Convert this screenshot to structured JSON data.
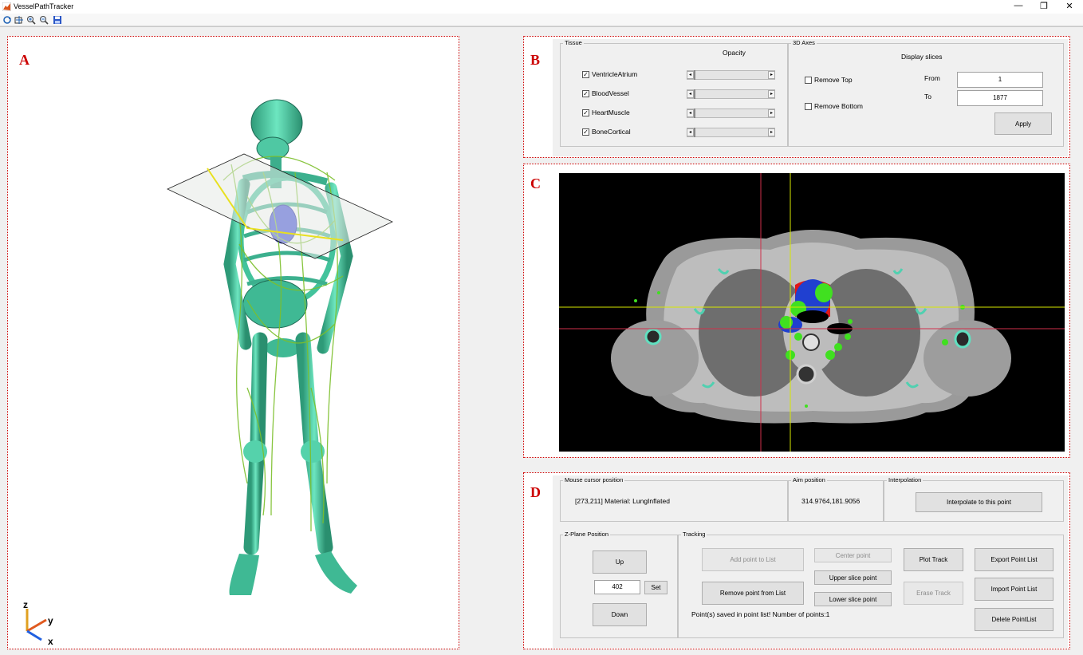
{
  "window": {
    "title": "VesselPathTracker"
  },
  "toolbar": {
    "buttons": [
      "rotate-icon",
      "data-cursor-icon",
      "zoom-in-icon",
      "zoom-out-icon",
      "save-icon"
    ]
  },
  "regions": {
    "a": "A",
    "b": "B",
    "c": "C",
    "d": "D"
  },
  "volume_view": {
    "axes": {
      "z": "z",
      "y": "y",
      "x": "x"
    }
  },
  "tissue_panel": {
    "title": "Tissue",
    "opacity_label": "Opacity",
    "items": [
      {
        "label": "VentricleAtrium",
        "checked": true
      },
      {
        "label": "BloodVessel",
        "checked": true
      },
      {
        "label": "HeartMuscle",
        "checked": true
      },
      {
        "label": "BoneCortical",
        "checked": true
      }
    ]
  },
  "axes_panel": {
    "title": "3D Axes",
    "display_slices_label": "Display slices",
    "remove_top_label": "Remove Top",
    "remove_bottom_label": "Remove Bottom",
    "remove_top_checked": false,
    "remove_bottom_checked": false,
    "from_label": "From",
    "to_label": "To",
    "from_value": "1",
    "to_value": "1877",
    "apply_label": "Apply"
  },
  "mouse_panel": {
    "title": "Mouse cursor  position",
    "value": "[273,211] Material:  LungInflated"
  },
  "aim_panel": {
    "title": "Aim position",
    "value": "314.9764,181.9056"
  },
  "interp_panel": {
    "title": "Interpolation",
    "button_label": "Interpolate to this point"
  },
  "zplane_panel": {
    "title": "Z-Plane Position",
    "up_label": "Up",
    "value": "402",
    "set_label": "Set",
    "down_label": "Down"
  },
  "tracking_panel": {
    "title": "Tracking",
    "add_point_label": "Add point to List",
    "remove_point_label": "Remove point from List",
    "center_point_label": "Center point",
    "upper_slice_label": "Upper slice point",
    "lower_slice_label": "Lower slice point",
    "plot_track_label": "Plot Track",
    "erase_track_label": "Erase Track",
    "export_label": "Export Point List",
    "import_label": "Import Point List",
    "delete_label": "Delete PointList",
    "status": "Point(s) saved in point list! Number of points:1"
  },
  "colors": {
    "region_border": "#cc0000",
    "ct_vessel": "#40e020",
    "ct_ventricle_blue": "#2040d0",
    "ct_atrium_red": "#e01818",
    "crosshair_yellow": "#d8e800",
    "crosshair_red": "#d0304a"
  }
}
